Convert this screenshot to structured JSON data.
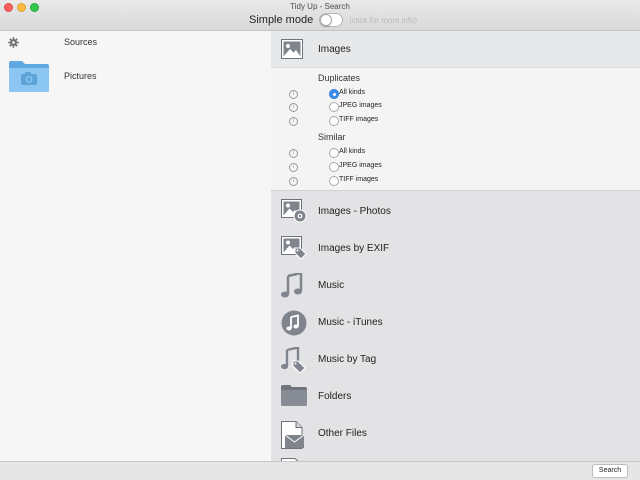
{
  "window": {
    "title": "Tidy Up - Search"
  },
  "toolbar": {
    "simple_mode_label": "Simple mode",
    "simple_mode_on": false,
    "simple_mode_hint": "(click for more info)"
  },
  "sidebar": {
    "sources_label": "Sources",
    "sources_icon": "gear-icon",
    "items": [
      {
        "label": "Pictures",
        "icon": "blue-folder-camera-icon"
      }
    ]
  },
  "search_types": {
    "selected": {
      "label": "Images",
      "icon": "image-icon",
      "groups": [
        {
          "title": "Duplicates",
          "options": [
            {
              "label": "All kinds",
              "selected": true
            },
            {
              "label": "JPEG images",
              "selected": false
            },
            {
              "label": "TIFF images",
              "selected": false
            }
          ]
        },
        {
          "title": "Similar",
          "options": [
            {
              "label": "All kinds",
              "selected": false
            },
            {
              "label": "JPEG images",
              "selected": false
            },
            {
              "label": "TIFF images",
              "selected": false
            }
          ]
        }
      ]
    },
    "others": [
      {
        "label": "Images - Photos",
        "icon": "photo-gear-icon"
      },
      {
        "label": "Images by EXIF",
        "icon": "image-tag-icon"
      },
      {
        "label": "Music",
        "icon": "music-note-icon"
      },
      {
        "label": "Music - iTunes",
        "icon": "itunes-icon"
      },
      {
        "label": "Music by Tag",
        "icon": "music-tag-icon"
      },
      {
        "label": "Folders",
        "icon": "folder-icon"
      },
      {
        "label": "Other Files",
        "icon": "other-files-icon"
      }
    ]
  },
  "footer": {
    "search_label": "Search"
  }
}
